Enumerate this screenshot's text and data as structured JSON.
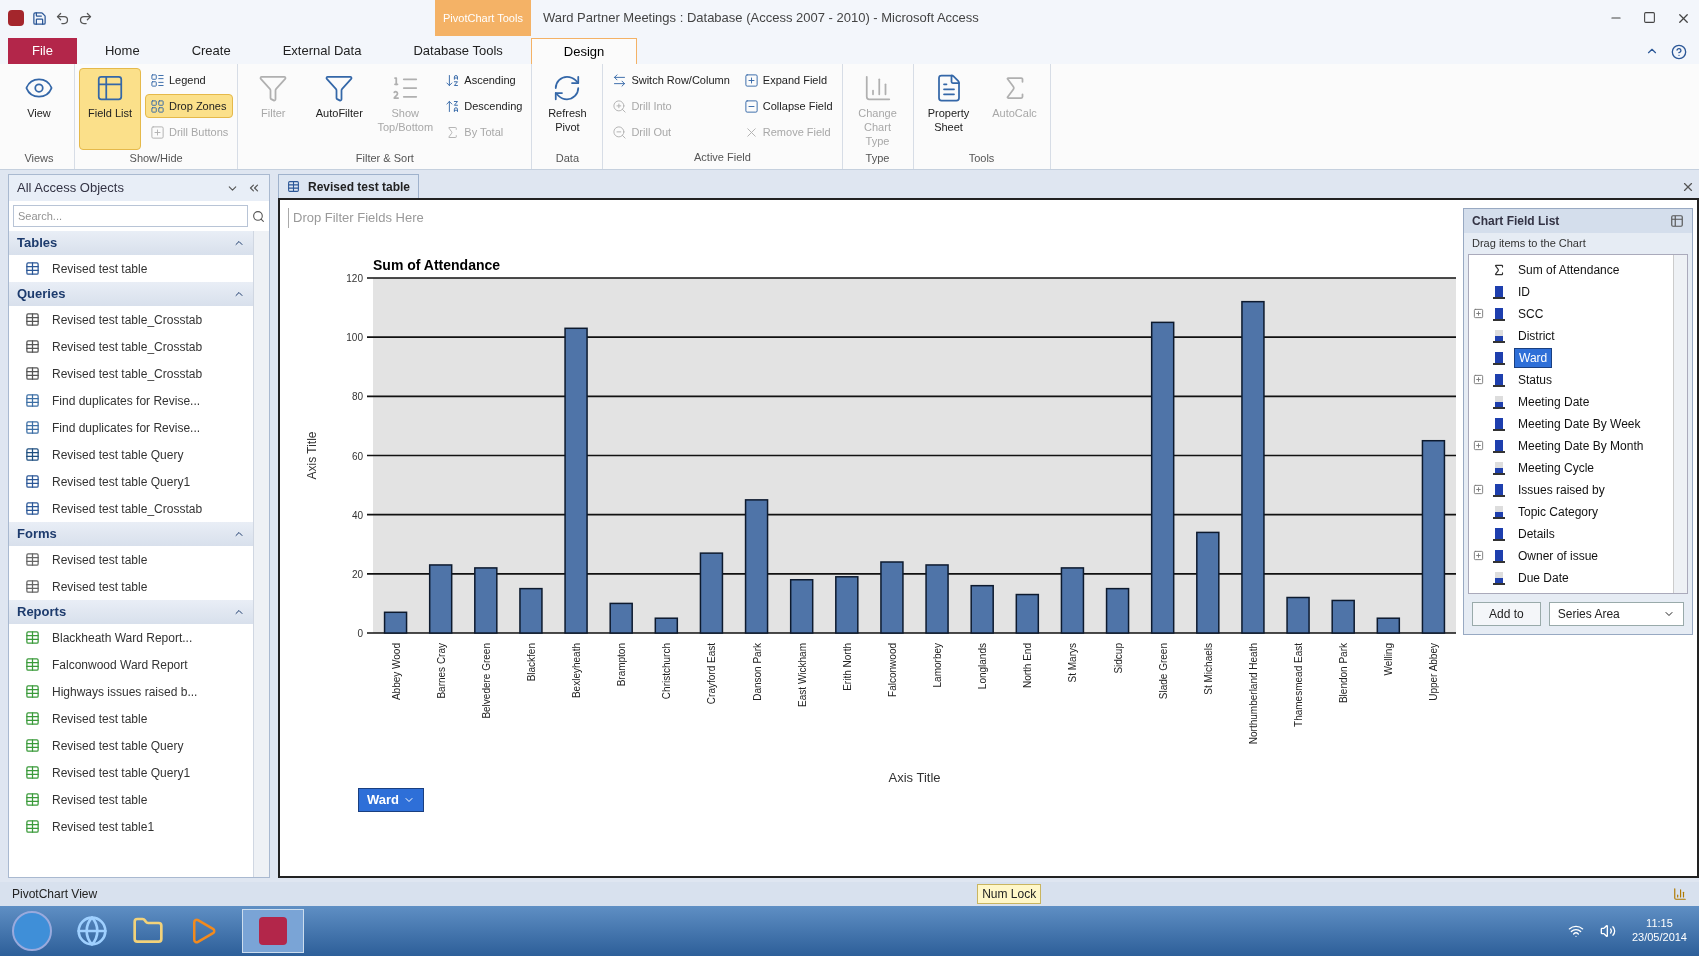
{
  "title_bar": {
    "contextual_tab": "PivotChart Tools",
    "title": "Ward Partner Meetings : Database (Access 2007 - 2010) - Microsoft Access"
  },
  "ribbon_tabs": [
    {
      "label": "File",
      "kind": "file",
      "selected": false
    },
    {
      "label": "Home",
      "kind": "tab",
      "selected": false
    },
    {
      "label": "Create",
      "kind": "tab",
      "selected": false
    },
    {
      "label": "External Data",
      "kind": "tab",
      "selected": false
    },
    {
      "label": "Database Tools",
      "kind": "tab",
      "selected": false
    },
    {
      "label": "Design",
      "kind": "tab",
      "selected": true
    }
  ],
  "ribbon_groups": [
    {
      "label": "Views",
      "columns": [
        [
          {
            "label": "View",
            "kind": "large",
            "selected": false,
            "disabled": false
          }
        ]
      ]
    },
    {
      "label": "Show/Hide",
      "columns": [
        [
          {
            "label": "Field List",
            "kind": "large",
            "selected": true,
            "disabled": false
          }
        ],
        [
          {
            "label": "Legend",
            "kind": "small",
            "selected": false,
            "disabled": false
          },
          {
            "label": "Drop Zones",
            "kind": "small",
            "selected": true,
            "disabled": false
          },
          {
            "label": "Drill Buttons",
            "kind": "small",
            "selected": false,
            "disabled": true
          }
        ]
      ]
    },
    {
      "label": "Filter & Sort",
      "columns": [
        [
          {
            "label": "Filter",
            "kind": "large",
            "selected": false,
            "disabled": true
          }
        ],
        [
          {
            "label": "AutoFilter",
            "kind": "large",
            "selected": false,
            "disabled": false
          }
        ],
        [
          {
            "label": "Show Top/Bottom",
            "kind": "large",
            "selected": false,
            "disabled": true
          }
        ],
        [
          {
            "label": "Ascending",
            "kind": "small",
            "selected": false,
            "disabled": false
          },
          {
            "label": "Descending",
            "kind": "small",
            "selected": false,
            "disabled": false
          },
          {
            "label": "By Total",
            "kind": "small",
            "selected": false,
            "disabled": true
          }
        ]
      ]
    },
    {
      "label": "Data",
      "columns": [
        [
          {
            "label": "Refresh Pivot",
            "kind": "large",
            "selected": false,
            "disabled": false
          }
        ]
      ]
    },
    {
      "label": "Active Field",
      "columns": [
        [
          {
            "label": "Switch Row/Column",
            "kind": "small",
            "selected": false,
            "disabled": false
          },
          {
            "label": "Drill Into",
            "kind": "small",
            "selected": false,
            "disabled": true
          },
          {
            "label": "Drill Out",
            "kind": "small",
            "selected": false,
            "disabled": true
          }
        ],
        [
          {
            "label": "Expand Field",
            "kind": "small",
            "selected": false,
            "disabled": false
          },
          {
            "label": "Collapse Field",
            "kind": "small",
            "selected": false,
            "disabled": false
          },
          {
            "label": "Remove Field",
            "kind": "small",
            "selected": false,
            "disabled": true
          }
        ]
      ]
    },
    {
      "label": "Type",
      "columns": [
        [
          {
            "label": "Change Chart Type",
            "kind": "large",
            "selected": false,
            "disabled": true
          }
        ]
      ]
    },
    {
      "label": "Tools",
      "columns": [
        [
          {
            "label": "Property Sheet",
            "kind": "large",
            "selected": false,
            "disabled": false
          }
        ],
        [
          {
            "label": "AutoCalc",
            "kind": "large",
            "selected": false,
            "disabled": true
          }
        ]
      ]
    }
  ],
  "nav": {
    "title": "All Access Objects",
    "search_placeholder": "Search...",
    "groups": [
      {
        "label": "Tables",
        "expanded": true,
        "items": [
          {
            "label": "Revised test table",
            "kind": "table"
          }
        ]
      },
      {
        "label": "Queries",
        "expanded": true,
        "items": [
          {
            "label": "Revised test table_Crosstab",
            "kind": "crosstab"
          },
          {
            "label": "Revised test table_Crosstab",
            "kind": "crosstab"
          },
          {
            "label": "Revised test table_Crosstab",
            "kind": "crosstab"
          },
          {
            "label": "Find duplicates for Revise...",
            "kind": "duplicate"
          },
          {
            "label": "Find duplicates for Revise...",
            "kind": "duplicate"
          },
          {
            "label": "Revised test table Query",
            "kind": "update"
          },
          {
            "label": "Revised test table Query1",
            "kind": "select"
          },
          {
            "label": "Revised test table_Crosstab",
            "kind": "select"
          }
        ]
      },
      {
        "label": "Forms",
        "expanded": true,
        "items": [
          {
            "label": "Revised test table",
            "kind": "form"
          },
          {
            "label": "Revised test table",
            "kind": "form"
          }
        ]
      },
      {
        "label": "Reports",
        "expanded": true,
        "items": [
          {
            "label": "Blackheath Ward Report...",
            "kind": "report"
          },
          {
            "label": "Falconwood Ward Report",
            "kind": "report"
          },
          {
            "label": "Highways issues raised b...",
            "kind": "report"
          },
          {
            "label": "Revised test table",
            "kind": "report"
          },
          {
            "label": "Revised test table Query",
            "kind": "report"
          },
          {
            "label": "Revised test table Query1",
            "kind": "report"
          },
          {
            "label": "Revised test table",
            "kind": "report"
          },
          {
            "label": "Revised test table1",
            "kind": "report"
          }
        ]
      }
    ]
  },
  "document_tab": {
    "label": "Revised test table"
  },
  "chart": {
    "filter_zone": "Drop Filter Fields Here",
    "category_button": "Ward",
    "chart_data": {
      "type": "bar",
      "title": "Sum of Attendance",
      "xlabel": "Axis Title",
      "ylabel": "Axis Title",
      "grid": true,
      "categories": [
        "Abbey Wood",
        "Barnes Cray",
        "Belvedere Green",
        "Blackfen",
        "Bexleyheath",
        "Brampton",
        "Christchurch",
        "Crayford East",
        "Danson Park",
        "East Wickham",
        "Erith North",
        "Falconwood",
        "Lamorbey",
        "Longlands",
        "North End",
        "St Marys",
        "Sidcup",
        "Slade Green",
        "St Michaels",
        "Northumberland Heath",
        "Thamesmead East",
        "Blendon Park",
        "Welling",
        "Upper Abbey"
      ],
      "series": [
        {
          "color": "#4f74a8",
          "values": [
            7,
            23,
            22,
            15,
            103,
            10,
            5,
            27,
            45,
            18,
            19,
            24,
            23,
            16,
            13,
            22,
            15,
            105,
            34,
            112,
            12,
            11,
            5,
            65
          ]
        }
      ],
      "ylim": [
        0,
        120
      ],
      "yticks": [
        0,
        20,
        40,
        60,
        80,
        100,
        120
      ]
    }
  },
  "field_list": {
    "title": "Chart Field List",
    "hint": "Drag items to the Chart",
    "items": [
      {
        "label": "Sum of Attendance",
        "kind": "total",
        "expandable": false,
        "selected": false
      },
      {
        "label": "ID",
        "kind": "field",
        "expandable": false,
        "selected": false
      },
      {
        "label": "SCC",
        "kind": "field",
        "expandable": true,
        "selected": false
      },
      {
        "label": "District",
        "kind": "date",
        "expandable": false,
        "selected": false
      },
      {
        "label": "Ward",
        "kind": "field",
        "expandable": false,
        "selected": true
      },
      {
        "label": "Status",
        "kind": "field",
        "expandable": true,
        "selected": false
      },
      {
        "label": "Meeting Date",
        "kind": "date",
        "expandable": false,
        "selected": false
      },
      {
        "label": "Meeting Date By Week",
        "kind": "field",
        "expandable": false,
        "selected": false
      },
      {
        "label": "Meeting Date By Month",
        "kind": "field",
        "expandable": true,
        "selected": false
      },
      {
        "label": "Meeting Cycle",
        "kind": "date",
        "expandable": false,
        "selected": false
      },
      {
        "label": "Issues raised by",
        "kind": "field",
        "expandable": true,
        "selected": false
      },
      {
        "label": "Topic Category",
        "kind": "date",
        "expandable": false,
        "selected": false
      },
      {
        "label": "Details",
        "kind": "field",
        "expandable": false,
        "selected": false
      },
      {
        "label": "Owner of issue",
        "kind": "field",
        "expandable": true,
        "selected": false
      },
      {
        "label": "Due Date",
        "kind": "date",
        "expandable": false,
        "selected": false
      }
    ],
    "add_button": "Add to",
    "area_select": "Series Area"
  },
  "status_bar": {
    "view": "PivotChart View",
    "indicator": "Num Lock"
  },
  "taskbar": {
    "time": "11:15",
    "date": "23/05/2014"
  }
}
